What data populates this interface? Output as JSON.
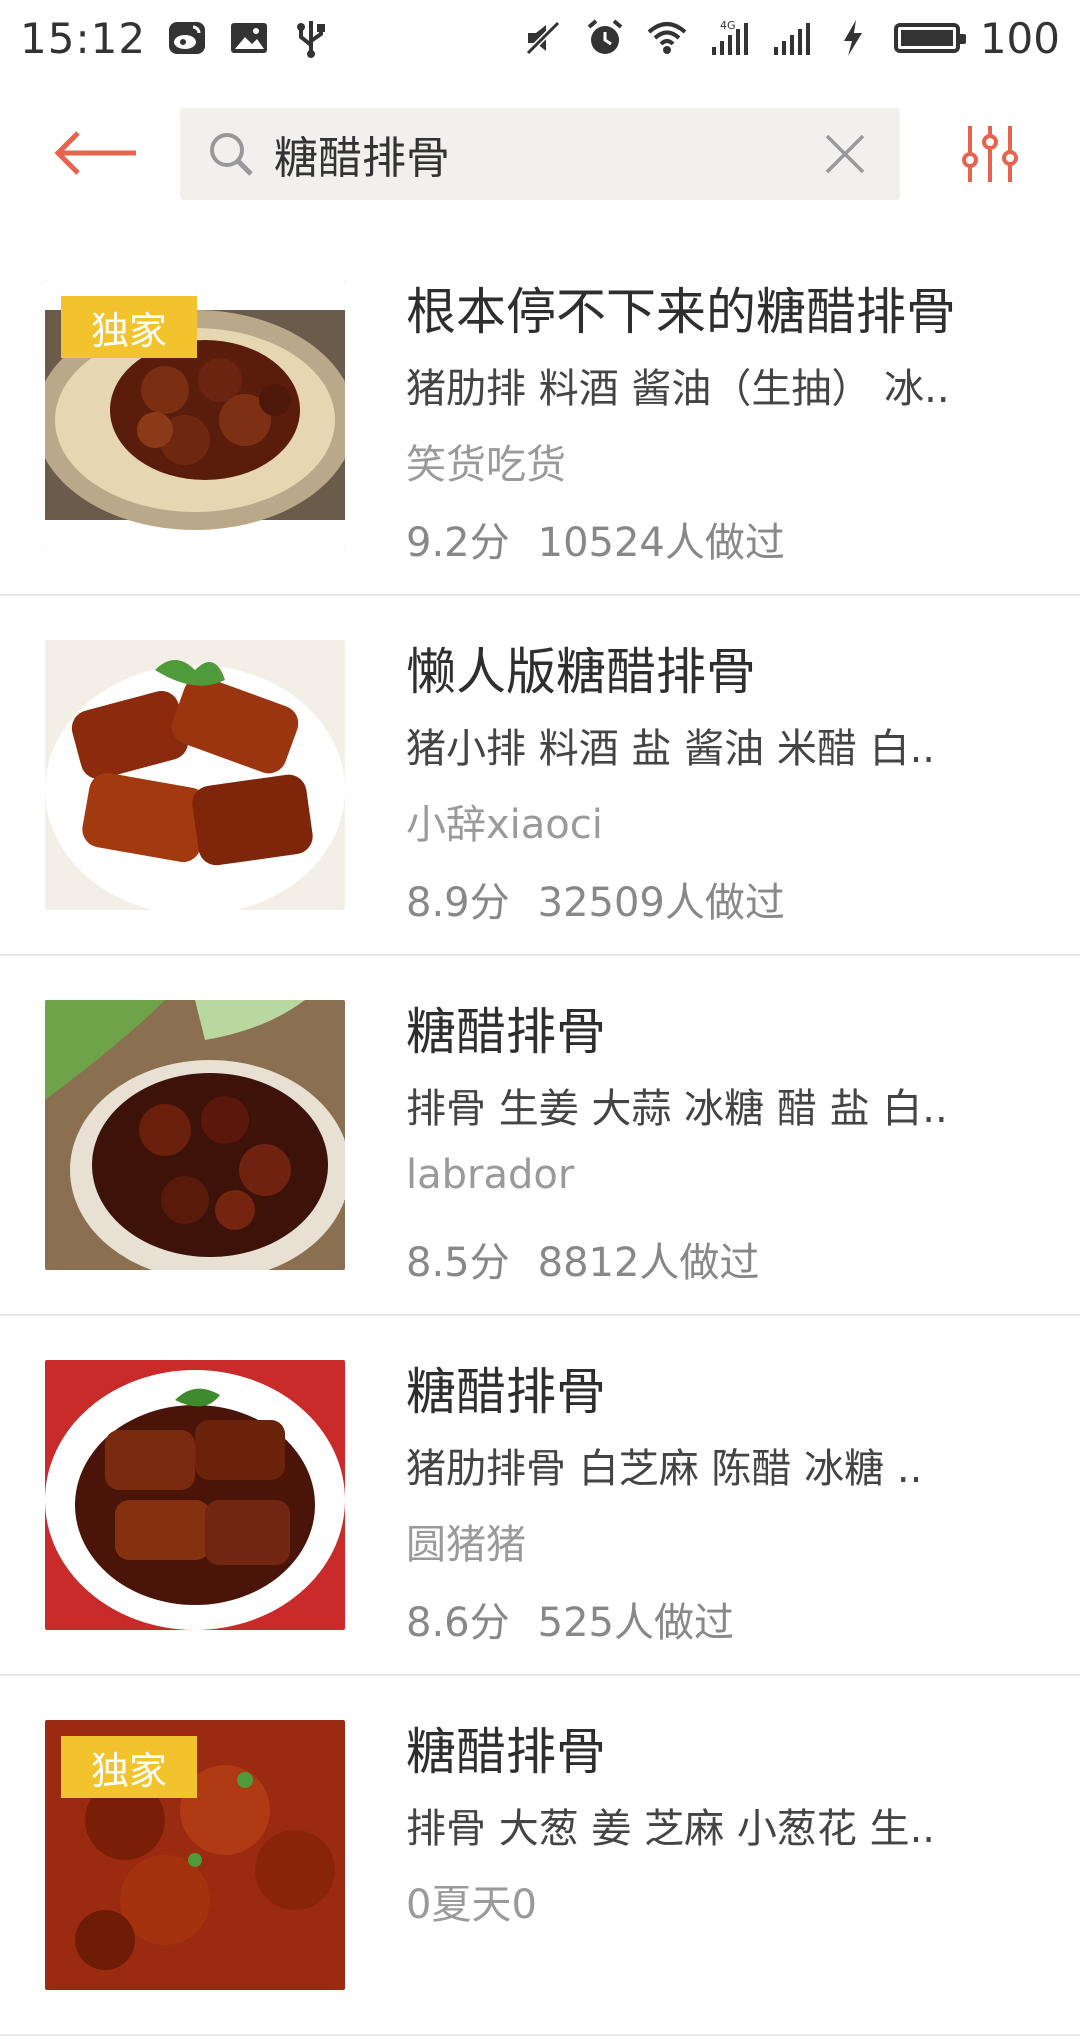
{
  "status_bar": {
    "time": "15:12",
    "battery": "100",
    "battery_level": 1.0,
    "network": "4G"
  },
  "search": {
    "query": "糖醋排骨",
    "accent_color": "#e8634d"
  },
  "badge_label": "独家",
  "recipes": [
    {
      "title": "根本停不下来的糖醋排骨",
      "ingredients": "猪肋排 料酒 酱油（生抽） 冰..",
      "author": "笑货吃货",
      "score": "9.2分",
      "made": "10524人做过",
      "exclusive": true
    },
    {
      "title": "懒人版糖醋排骨",
      "ingredients": "猪小排 料酒 盐 酱油 米醋 白..",
      "author": "小辞xiaoci",
      "score": "8.9分",
      "made": "32509人做过",
      "exclusive": false
    },
    {
      "title": "糖醋排骨",
      "ingredients": "排骨 生姜 大蒜 冰糖 醋 盐 白..",
      "author": "labrador",
      "score": "8.5分",
      "made": "8812人做过",
      "exclusive": false
    },
    {
      "title": "糖醋排骨",
      "ingredients": "猪肋排骨 白芝麻 陈醋 冰糖 ..",
      "author": "圆猪猪",
      "score": "8.6分",
      "made": "525人做过",
      "exclusive": false
    },
    {
      "title": "糖醋排骨",
      "ingredients": "排骨 大葱 姜 芝麻 小葱花 生..",
      "author": "0夏天0",
      "score": "",
      "made": "",
      "exclusive": true
    }
  ]
}
